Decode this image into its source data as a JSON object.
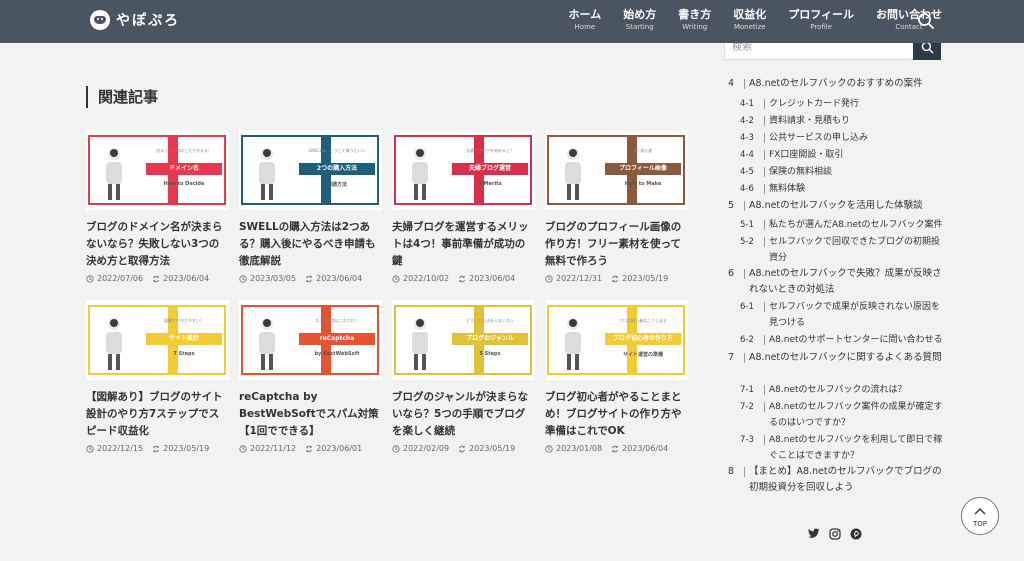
{
  "header": {
    "logo_text": "やぽぷろ",
    "nav": [
      {
        "jp": "ホーム",
        "en": "Home"
      },
      {
        "jp": "始め方",
        "en": "Starting"
      },
      {
        "jp": "書き方",
        "en": "Writing"
      },
      {
        "jp": "収益化",
        "en": "Monetize"
      },
      {
        "jp": "プロフィール",
        "en": "Profile"
      },
      {
        "jp": "お問い合わせ",
        "en": "Contact"
      }
    ]
  },
  "search": {
    "placeholder": "検索"
  },
  "related": {
    "heading": "関連記事",
    "cards": [
      {
        "title": "ブログのドメイン名が決まらないなら？失敗しない3つの決め方と取得方法",
        "published": "2022/07/06",
        "updated": "2023/06/04",
        "thumb_label": "ドメイン名",
        "thumb_sub": "決まらない時はこれで決まる！",
        "thumb_en": "How to Decide",
        "accent": "#e8384f"
      },
      {
        "title": "SWELLの購入方法は2つある？購入後にやるべき申請も徹底解説",
        "published": "2023/03/05",
        "updated": "2023/06/04",
        "thumb_label": "2つの購入方法",
        "thumb_sub": "SWELLは、こうして買うといい",
        "thumb_en": "申請方法",
        "accent": "#1f5f7a"
      },
      {
        "title": "夫婦ブログを運営するメリットは4つ！事前準備が成功の鍵",
        "published": "2022/10/02",
        "updated": "2023/06/04",
        "thumb_label": "夫婦ブログ運営",
        "thumb_sub": "夫婦でブログを始めると？",
        "thumb_en": "4 Merits",
        "accent": "#d8304a"
      },
      {
        "title": "ブログのプロフィール画像の作り方！フリー素材を使って無料で作ろう",
        "published": "2022/12/31",
        "updated": "2023/05/19",
        "thumb_label": "プロフィール画像",
        "thumb_sub": "for 初心者",
        "thumb_en": "How to Make",
        "accent": "#8a5a3c"
      },
      {
        "title": "【図解あり】ブログのサイト設計のやり方7ステップでスピード収益化",
        "published": "2022/12/15",
        "updated": "2023/05/19",
        "thumb_label": "サイト設計",
        "thumb_sub": "図解でわかりやすい！",
        "thumb_en": "7 Steps",
        "accent": "#f2cc36"
      },
      {
        "title": "reCaptcha by BestWebSoftでスパム対策【1回でできる】",
        "published": "2022/11/12",
        "updated": "2023/06/01",
        "thumb_label": "reCaptcha",
        "thumb_sub": "スパム対策はこれだけ！",
        "thumb_en": "by BestWebSoft",
        "accent": "#e4542f"
      },
      {
        "title": "ブログのジャンルが決まらないなら？5つの手順でブログを楽しく継続",
        "published": "2022/02/09",
        "updated": "2023/05/19",
        "thumb_label": "ブログのジャンル",
        "thumb_sub": "どうしても決まらないなら",
        "thumb_en": "5 Steps",
        "accent": "#e0c23a"
      },
      {
        "title": "ブログ初心者がやることまとめ！ブログサイトの作り方や準備はこれでOK",
        "published": "2023/01/08",
        "updated": "2023/06/04",
        "thumb_label": "ブログ初心者の作り方",
        "thumb_sub": "ブログ初心者はこうします",
        "thumb_en": "サイト運営の準備",
        "accent": "#f2cc36"
      }
    ]
  },
  "toc": {
    "items": [
      {
        "num": "4",
        "text": "A8.netのセルフバックのおすすめの案件",
        "level": 1
      },
      {
        "num": "4-1",
        "text": "クレジットカード発行",
        "level": 2
      },
      {
        "num": "4-2",
        "text": "資料請求・見積もり",
        "level": 2
      },
      {
        "num": "4-3",
        "text": "公共サービスの申し込み",
        "level": 2
      },
      {
        "num": "4-4",
        "text": "FX口座開設・取引",
        "level": 2
      },
      {
        "num": "4-5",
        "text": "保険の無料相談",
        "level": 2
      },
      {
        "num": "4-6",
        "text": "無料体験",
        "level": 2
      },
      {
        "num": "5",
        "text": "A8.netのセルフバックを活用した体験談",
        "level": 1
      },
      {
        "num": "5-1",
        "text": "私たちが選んだA8.netのセルフバック案件",
        "level": 2
      },
      {
        "num": "5-2",
        "text": "セルフバックで回収できたブログの初期投資分",
        "level": 2
      },
      {
        "num": "6",
        "text": "A8.netのセルフバックで失敗？成果が反映されないときの対処法",
        "level": 1
      },
      {
        "num": "6-1",
        "text": "セルフバックで成果が反映されない原因を見つける",
        "level": 2
      },
      {
        "num": "6-2",
        "text": "A8.netのサポートセンターに問い合わせる",
        "level": 2
      },
      {
        "num": "7",
        "text": "A8.netのセルフバックに関するよくある質問",
        "level": 1
      },
      {
        "num": "7-1",
        "text": "A8.netのセルフバックの流れは？",
        "level": 2
      },
      {
        "num": "7-2",
        "text": "A8.netのセルフバック案件の成果が確定するのはいつですか？",
        "level": 2
      },
      {
        "num": "7-3",
        "text": "A8.netのセルフバックを利用して即日で稼ぐことはできますか？",
        "level": 2
      },
      {
        "num": "8",
        "text": "【まとめ】A8.netのセルフバックでブログの初期投資分を回収しよう",
        "level": 1
      }
    ]
  },
  "top_button": {
    "label": "TOP"
  },
  "colors": {
    "header_bg": "#4a5562",
    "search_btn": "#2c3b4a",
    "page_bg": "#f2f2f2"
  },
  "icons": [
    "logo-mascot-icon",
    "search-icon",
    "clock-icon",
    "refresh-icon",
    "twitter-icon",
    "instagram-icon",
    "pinterest-icon",
    "chevron-up-icon"
  ]
}
